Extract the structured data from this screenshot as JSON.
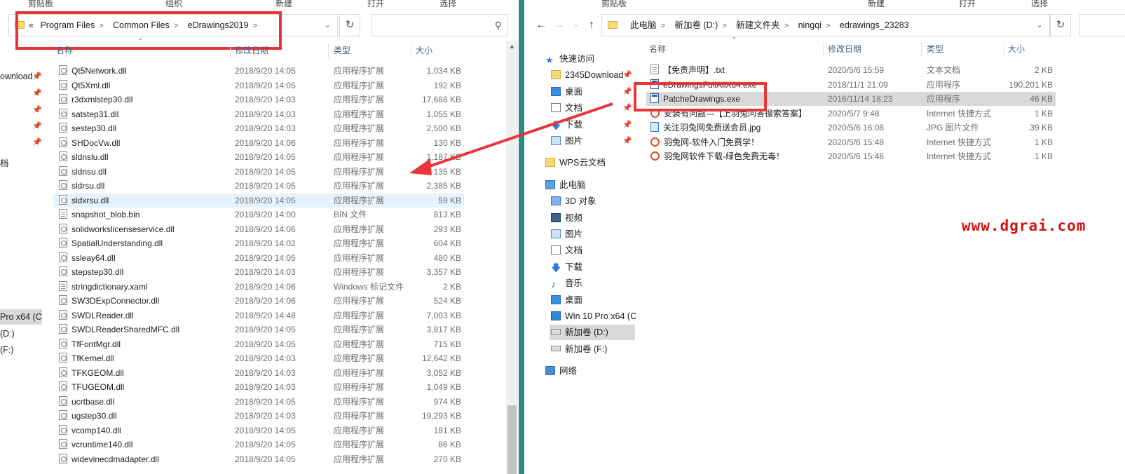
{
  "colors": {
    "highlight": "#e8353a",
    "watermark": "#d11414",
    "selected_row": "#e5f3ff",
    "divider": "#2f8a86"
  },
  "left": {
    "ribbon": [
      "剪贴板",
      "组织",
      "新建",
      "打开",
      "选择"
    ],
    "breadcrumb": {
      "overflow": "«",
      "parts": [
        "Program Files",
        "Common Files",
        "eDrawings2019"
      ]
    },
    "columns": {
      "name": "名称",
      "date": "修改日期",
      "type": "类型",
      "size": "大小"
    },
    "nav": [
      {
        "label": "ownload",
        "pin": true
      },
      {
        "label": "",
        "pin": true
      },
      {
        "label": "",
        "pin": true
      },
      {
        "label": "",
        "pin": true
      },
      {
        "label": "",
        "pin": true
      },
      {
        "label": "档",
        "pin": false
      },
      {
        "label": "",
        "pin": false
      },
      {
        "label": "",
        "pin": false
      },
      {
        "label": "Pro x64 (C",
        "pin": false,
        "selected": true
      },
      {
        "label": "(D:)",
        "pin": false
      },
      {
        "label": "(F:)",
        "pin": false
      }
    ],
    "files": [
      {
        "icon": "dll",
        "name": "Qt5Network.dll",
        "date": "2018/9/20 14:05",
        "type": "应用程序扩展",
        "size": "1,034 KB"
      },
      {
        "icon": "dll",
        "name": "Qt5Xml.dll",
        "date": "2018/9/20 14:05",
        "type": "应用程序扩展",
        "size": "192 KB"
      },
      {
        "icon": "dll",
        "name": "r3dxmlstep30.dll",
        "date": "2018/9/20 14:03",
        "type": "应用程序扩展",
        "size": "17,688 KB"
      },
      {
        "icon": "dll",
        "name": "satstep31.dll",
        "date": "2018/9/20 14:03",
        "type": "应用程序扩展",
        "size": "1,055 KB"
      },
      {
        "icon": "dll",
        "name": "sestep30.dll",
        "date": "2018/9/20 14:03",
        "type": "应用程序扩展",
        "size": "2,500 KB"
      },
      {
        "icon": "dll",
        "name": "SHDocVw.dll",
        "date": "2018/9/20 14:06",
        "type": "应用程序扩展",
        "size": "130 KB"
      },
      {
        "icon": "dll",
        "name": "sldnslu.dll",
        "date": "2018/9/20 14:05",
        "type": "应用程序扩展",
        "size": "1,187 KB"
      },
      {
        "icon": "dll",
        "name": "sldnsu.dll",
        "date": "2018/9/20 14:05",
        "type": "应用程序扩展",
        "size": "135 KB"
      },
      {
        "icon": "dll",
        "name": "sldrsu.dll",
        "date": "2018/9/20 14:05",
        "type": "应用程序扩展",
        "size": "2,385 KB"
      },
      {
        "icon": "dll",
        "name": "sldxrsu.dll",
        "date": "2018/9/20 14:05",
        "type": "应用程序扩展",
        "size": "59 KB",
        "selected": true
      },
      {
        "icon": "txt",
        "name": "snapshot_blob.bin",
        "date": "2018/9/20 14:00",
        "type": "BIN 文件",
        "size": "813 KB"
      },
      {
        "icon": "dll",
        "name": "solidworkslicenseservice.dll",
        "date": "2018/9/20 14:06",
        "type": "应用程序扩展",
        "size": "293 KB"
      },
      {
        "icon": "dll",
        "name": "SpatialUnderstanding.dll",
        "date": "2018/9/20 14:02",
        "type": "应用程序扩展",
        "size": "604 KB"
      },
      {
        "icon": "dll",
        "name": "ssleay64.dll",
        "date": "2018/9/20 14:05",
        "type": "应用程序扩展",
        "size": "480 KB"
      },
      {
        "icon": "dll",
        "name": "stepstep30.dll",
        "date": "2018/9/20 14:03",
        "type": "应用程序扩展",
        "size": "3,357 KB"
      },
      {
        "icon": "txt",
        "name": "stringdictionary.xaml",
        "date": "2018/9/20 14:06",
        "type": "Windows 标记文件",
        "size": "2 KB"
      },
      {
        "icon": "dll",
        "name": "SW3DExpConnector.dll",
        "date": "2018/9/20 14:06",
        "type": "应用程序扩展",
        "size": "524 KB"
      },
      {
        "icon": "dll",
        "name": "SWDLReader.dll",
        "date": "2018/9/20 14:48",
        "type": "应用程序扩展",
        "size": "7,003 KB"
      },
      {
        "icon": "dll",
        "name": "SWDLReaderSharedMFC.dll",
        "date": "2018/9/20 14:05",
        "type": "应用程序扩展",
        "size": "3,817 KB"
      },
      {
        "icon": "dll",
        "name": "TfFontMgr.dll",
        "date": "2018/9/20 14:05",
        "type": "应用程序扩展",
        "size": "715 KB"
      },
      {
        "icon": "dll",
        "name": "TfKernel.dll",
        "date": "2018/9/20 14:03",
        "type": "应用程序扩展",
        "size": "12,642 KB"
      },
      {
        "icon": "dll",
        "name": "TFKGEOM.dll",
        "date": "2018/9/20 14:03",
        "type": "应用程序扩展",
        "size": "3,052 KB"
      },
      {
        "icon": "dll",
        "name": "TFUGEOM.dll",
        "date": "2018/9/20 14:03",
        "type": "应用程序扩展",
        "size": "1,049 KB"
      },
      {
        "icon": "dll",
        "name": "ucrtbase.dll",
        "date": "2018/9/20 14:05",
        "type": "应用程序扩展",
        "size": "974 KB"
      },
      {
        "icon": "dll",
        "name": "ugstep30.dll",
        "date": "2018/9/20 14:03",
        "type": "应用程序扩展",
        "size": "19,293 KB"
      },
      {
        "icon": "dll",
        "name": "vcomp140.dll",
        "date": "2018/9/20 14:05",
        "type": "应用程序扩展",
        "size": "181 KB"
      },
      {
        "icon": "dll",
        "name": "vcruntime140.dll",
        "date": "2018/9/20 14:05",
        "type": "应用程序扩展",
        "size": "86 KB"
      },
      {
        "icon": "dll",
        "name": "widevinecdmadapter.dll",
        "date": "2018/9/20 14:05",
        "type": "应用程序扩展",
        "size": "270 KB"
      }
    ]
  },
  "right": {
    "ribbon": [
      "剪贴板",
      "新建",
      "打开",
      "选择"
    ],
    "breadcrumb": {
      "parts": [
        "此电脑",
        "新加卷 (D:)",
        "新建文件夹",
        "ningqi",
        "edrawings_23283"
      ]
    },
    "columns": {
      "name": "名称",
      "date": "修改日期",
      "type": "类型",
      "size": "大小"
    },
    "nav": [
      {
        "icon": "star",
        "label": "快速访问",
        "indent": 0
      },
      {
        "icon": "folder",
        "label": "2345Download",
        "indent": 1,
        "pin": true
      },
      {
        "icon": "desk",
        "label": "桌面",
        "indent": 1,
        "pin": true
      },
      {
        "icon": "doc",
        "label": "文档",
        "indent": 1,
        "pin": true
      },
      {
        "icon": "dl",
        "label": "下载",
        "indent": 1,
        "pin": true
      },
      {
        "icon": "pic",
        "label": "图片",
        "indent": 1,
        "pin": true
      },
      {
        "icon": "wps",
        "label": "WPS云文档",
        "indent": 0,
        "gap": true
      },
      {
        "icon": "pc",
        "label": "此电脑",
        "indent": 0,
        "gap": true
      },
      {
        "icon": "3d",
        "label": "3D 对象",
        "indent": 1
      },
      {
        "icon": "vid",
        "label": "视频",
        "indent": 1
      },
      {
        "icon": "pic",
        "label": "图片",
        "indent": 1
      },
      {
        "icon": "doc",
        "label": "文档",
        "indent": 1
      },
      {
        "icon": "dl",
        "label": "下载",
        "indent": 1
      },
      {
        "icon": "music",
        "label": "音乐",
        "indent": 1
      },
      {
        "icon": "desk",
        "label": "桌面",
        "indent": 1
      },
      {
        "icon": "win",
        "label": "Win 10 Pro x64 (C",
        "indent": 1
      },
      {
        "icon": "drive",
        "label": "新加卷 (D:)",
        "indent": 1,
        "selected": true
      },
      {
        "icon": "drive",
        "label": "新加卷 (F:)",
        "indent": 1
      },
      {
        "icon": "net",
        "label": "网络",
        "indent": 0,
        "gap": true
      }
    ],
    "files": [
      {
        "icon": "txt",
        "name": "【免责声明】.txt",
        "date": "2020/5/6 15:59",
        "type": "文本文档",
        "size": "2 KB"
      },
      {
        "icon": "exe",
        "name": "eDrawingsFullAllX64.exe",
        "date": "2018/11/1 21:09",
        "type": "应用程序",
        "size": "190,201 KB"
      },
      {
        "icon": "exe",
        "name": "PatcheDrawings.exe",
        "date": "2016/11/14 18:23",
        "type": "应用程序",
        "size": "46 KB",
        "highlighted": true
      },
      {
        "icon": "web",
        "name": "安装有问题---【上羽兔问答搜索答案】",
        "date": "2020/5/7 9:48",
        "type": "Internet 快捷方式",
        "size": "1 KB"
      },
      {
        "icon": "jpg",
        "name": "关注羽兔网免费送会员.jpg",
        "date": "2020/5/6 16:08",
        "type": "JPG 图片文件",
        "size": "39 KB"
      },
      {
        "icon": "web",
        "name": "羽兔网-软件入门免费学！",
        "date": "2020/5/6 15:48",
        "type": "Internet 快捷方式",
        "size": "1 KB"
      },
      {
        "icon": "web",
        "name": "羽兔网软件下载-绿色免费无毒！",
        "date": "2020/5/6 15:46",
        "type": "Internet 快捷方式",
        "size": "1 KB"
      }
    ]
  },
  "watermark": "www.dgrai.com"
}
